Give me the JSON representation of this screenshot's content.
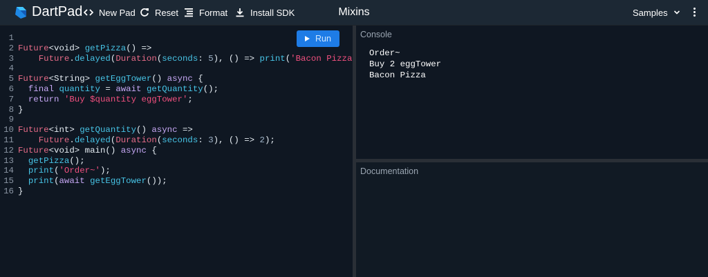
{
  "header": {
    "app_name": "DartPad",
    "buttons": {
      "new_pad": "New Pad",
      "reset": "Reset",
      "format": "Format",
      "install_sdk": "Install SDK"
    },
    "title": "Mixins",
    "samples": "Samples"
  },
  "editor": {
    "run_label": "Run",
    "line_numbers": [
      "1",
      "2",
      "3",
      "4",
      "5",
      "6",
      "7",
      "8",
      "9",
      "10",
      "11",
      "12",
      "13",
      "14",
      "15",
      "16"
    ]
  },
  "console": {
    "label": "Console",
    "output": [
      "Order~",
      "Buy 2 eggTower",
      "Bacon Pizza"
    ]
  },
  "documentation": {
    "label": "Documentation"
  },
  "colors": {
    "accent": "#1e7ce6",
    "background": "#0f1722",
    "header": "#1c2834"
  },
  "icons": [
    "dart-logo-icon",
    "code-brackets-icon",
    "refresh-icon",
    "format-lines-icon",
    "download-icon",
    "chevron-down-icon",
    "more-vert-icon",
    "play-icon"
  ]
}
